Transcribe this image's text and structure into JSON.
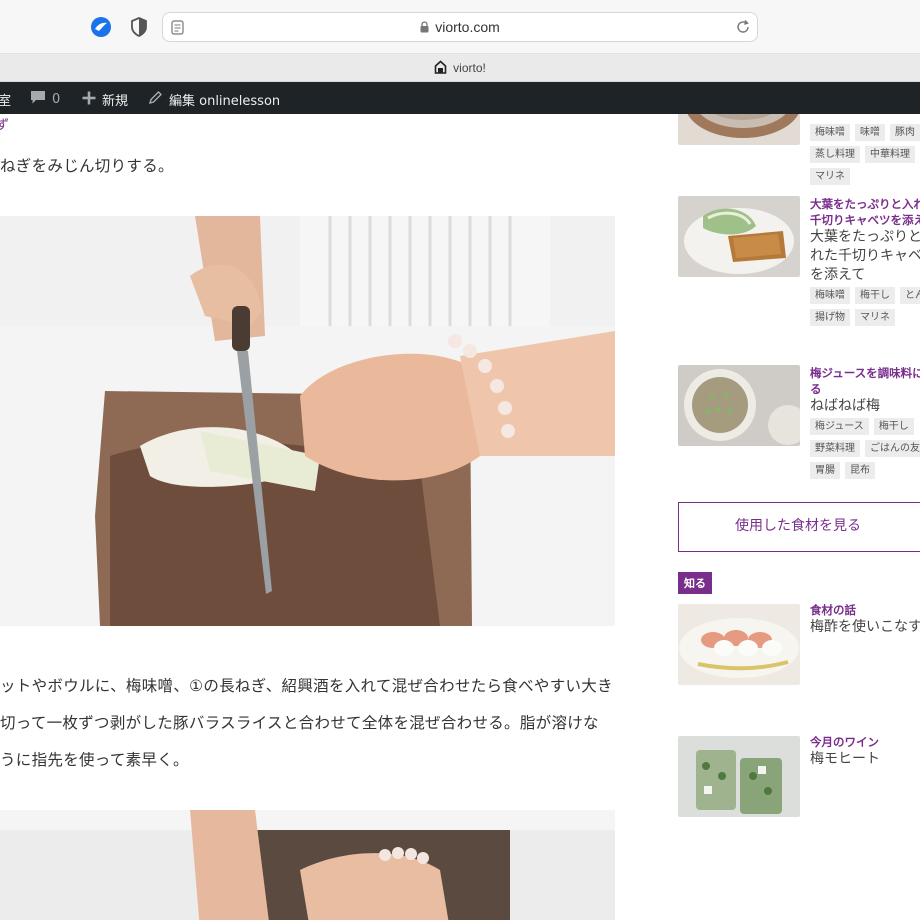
{
  "browser": {
    "url": "viorto.com",
    "tab_title": "viorto!"
  },
  "adminbar": {
    "site": "室",
    "comment_count": "0",
    "new_label": "新規",
    "edit_label": "編集 onlinelesson"
  },
  "article": {
    "partial_top": "ず",
    "step1_text": "ねぎをみじん切りする。",
    "step2_lines": [
      "ットやボウルに、梅味噌、①の長ねぎ、紹興酒を入れて混ぜ合わせたら食べやすい大き",
      "切って一枚ずつ剥がした豚バラスライスと合わせて全体を混ぜ合わせる。脂が溶けな",
      "うに指先を使って素早く。"
    ]
  },
  "sidebar": {
    "recipes": [
      {
        "subtitle": "",
        "title": "",
        "tags": [
          "梅味噌",
          "味噌",
          "豚肉",
          "蒸し料理",
          "中華料理",
          "マリネ"
        ]
      },
      {
        "subtitle": "大葉をたっぷりと入れ千切りキャベツを添え",
        "subtitle_lines": [
          "大葉をたっぷりと入れ",
          "千切りキャベツを添え"
        ],
        "title_lines": [
          "大葉をたっぷりと",
          "れた千切りキャベ",
          "を添えて"
        ],
        "tags": [
          "梅味噌",
          "梅干し",
          "とんかつ",
          "揚げ物",
          "マリネ"
        ]
      },
      {
        "subtitle_lines": [
          "梅ジュースを調味料に",
          "る"
        ],
        "title_lines": [
          "ねばねば梅"
        ],
        "tags": [
          "梅ジュース",
          "梅干し",
          "野菜料理",
          "ごはんの友",
          "胃腸",
          "昆布"
        ]
      }
    ],
    "ingredients_button": "使用した食材を見る",
    "know_badge": "知る",
    "articles": [
      {
        "category": "食材の話",
        "title": "梅酢を使いこなす"
      },
      {
        "category": "今月のワイン",
        "title": "梅モヒート"
      }
    ]
  },
  "colors": {
    "accent": "#7a2e8c",
    "adminbar": "#1d2327"
  }
}
